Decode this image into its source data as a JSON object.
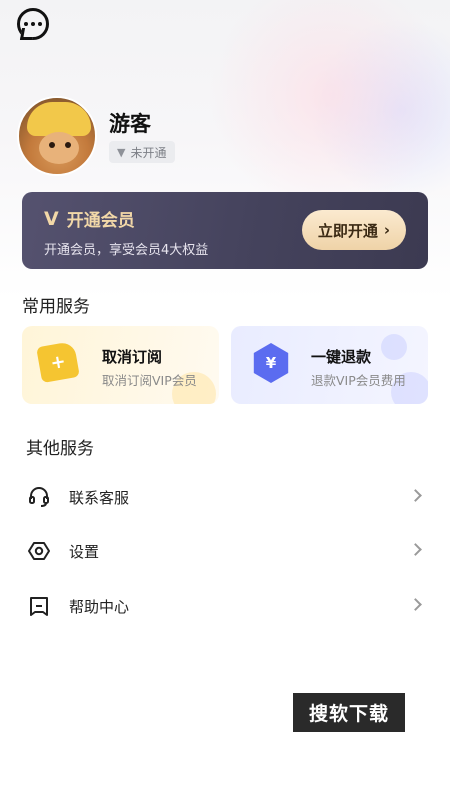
{
  "header": {
    "chat_icon": "chat-bubble-icon"
  },
  "profile": {
    "username": "游客",
    "vip_status": "未开通",
    "vip_status_icon": "vip-v-icon"
  },
  "member_card": {
    "title": "开通会员",
    "description": "开通会员，享受会员4大权益",
    "button_label": "立即开通",
    "button_chevron": "›",
    "accent_color": "#f2d8a8",
    "background_color": "#4a4862"
  },
  "common_services": {
    "title": "常用服务",
    "items": [
      {
        "title": "取消订阅",
        "subtitle": "取消订阅VIP会员",
        "icon": "flag-icon",
        "icon_glyph": "+",
        "color": "#f5c531"
      },
      {
        "title": "一键退款",
        "subtitle": "退款VIP会员费用",
        "icon": "yen-icon",
        "icon_glyph": "¥",
        "color": "#5b6cf0"
      }
    ]
  },
  "other_services": {
    "title": "其他服务",
    "items": [
      {
        "label": "联系客服",
        "icon": "headset-icon"
      },
      {
        "label": "设置",
        "icon": "settings-icon"
      },
      {
        "label": "帮助中心",
        "icon": "help-icon"
      }
    ]
  },
  "watermark": "搜软下载"
}
